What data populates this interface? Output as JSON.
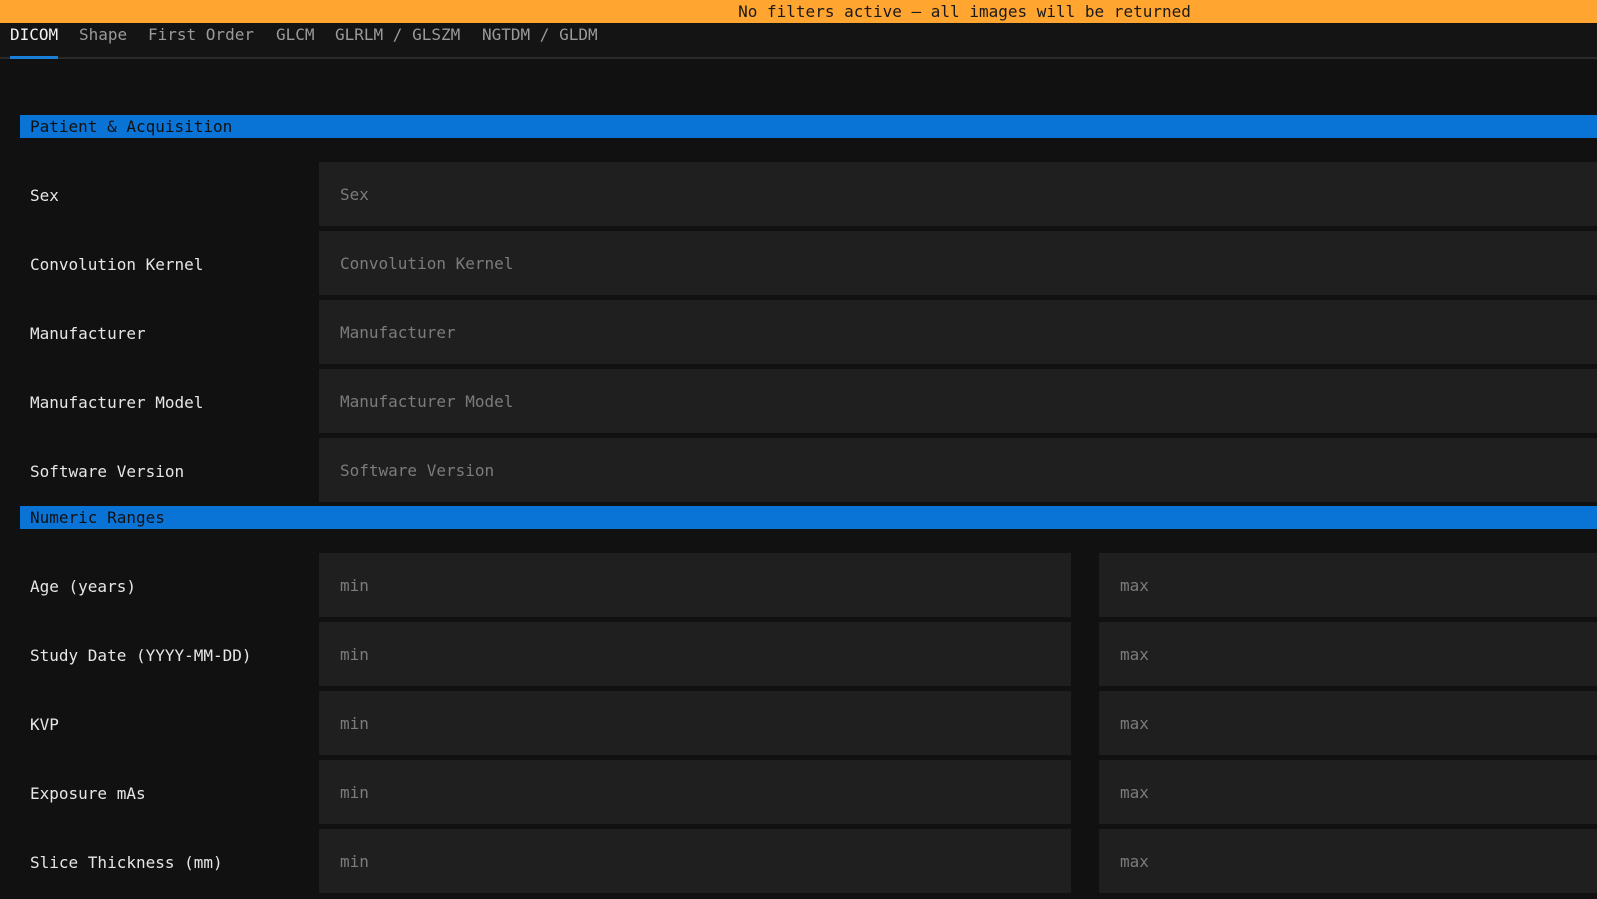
{
  "banner": {
    "text": "No filters active — all images will be returned"
  },
  "tabs": [
    {
      "label": "DICOM",
      "active": true
    },
    {
      "label": "Shape",
      "active": false
    },
    {
      "label": "First Order",
      "active": false
    },
    {
      "label": "GLCM",
      "active": false
    },
    {
      "label": "GLRLM / GLSZM",
      "active": false
    },
    {
      "label": "NGTDM / GLDM",
      "active": false
    }
  ],
  "sections": {
    "patient": {
      "title": "Patient & Acquisition",
      "fields": [
        {
          "label": "Sex",
          "placeholder": "Sex",
          "value": ""
        },
        {
          "label": "Convolution Kernel",
          "placeholder": "Convolution Kernel",
          "value": ""
        },
        {
          "label": "Manufacturer",
          "placeholder": "Manufacturer",
          "value": ""
        },
        {
          "label": "Manufacturer Model",
          "placeholder": "Manufacturer Model",
          "value": ""
        },
        {
          "label": "Software Version",
          "placeholder": "Software Version",
          "value": ""
        }
      ]
    },
    "numeric": {
      "title": "Numeric Ranges",
      "fields": [
        {
          "label": "Age (years)",
          "min_placeholder": "min",
          "max_placeholder": "max"
        },
        {
          "label": "Study Date (YYYY-MM-DD)",
          "min_placeholder": "min",
          "max_placeholder": "max"
        },
        {
          "label": "KVP",
          "min_placeholder": "min",
          "max_placeholder": "max"
        },
        {
          "label": "Exposure mAs",
          "min_placeholder": "min",
          "max_placeholder": "max"
        },
        {
          "label": "Slice Thickness (mm)",
          "min_placeholder": "min",
          "max_placeholder": "max"
        }
      ]
    }
  },
  "colors": {
    "banner_bg": "#ffa530",
    "accent": "#0a74d6",
    "background": "#111112",
    "field_bg": "#1f1f1f"
  }
}
